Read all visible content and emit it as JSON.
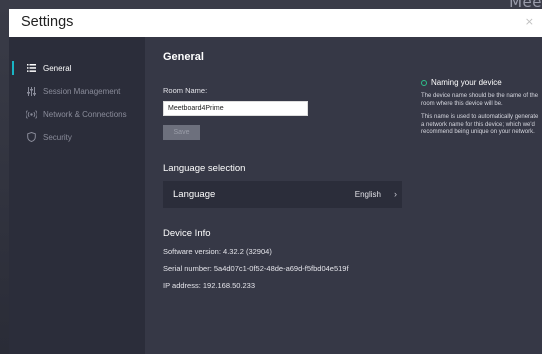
{
  "background_text": "Mee",
  "window": {
    "title": "Settings",
    "close_label": "×"
  },
  "sidebar": {
    "items": [
      {
        "label": "General",
        "icon": "list-icon",
        "active": true
      },
      {
        "label": "Session Management",
        "icon": "sliders-icon",
        "active": false
      },
      {
        "label": "Network & Connections",
        "icon": "broadcast-icon",
        "active": false
      },
      {
        "label": "Security",
        "icon": "shield-icon",
        "active": false
      }
    ]
  },
  "main": {
    "heading": "General",
    "room_name_label": "Room Name:",
    "room_name_value": "Meetboard4Prime",
    "save_label": "Save",
    "language_section": "Language selection",
    "language_label": "Language",
    "language_value": "English",
    "device_info_heading": "Device Info",
    "software_version": "Software version:  4.32.2 (32904)",
    "serial_number": "Serial number:  5a4d07c1-0f52-48de-a69d-f5fbd04e519f",
    "ip_address": "IP address:  192.168.50.233"
  },
  "help": {
    "title": "Naming your device",
    "paragraph1": "The device name should be the name of the room where this device will be.",
    "paragraph2": "This name is used to automatically generate a network name for this device; which we'd recommend being unique on your network."
  },
  "colors": {
    "accent": "#19b4c4",
    "status_dot": "#2dc08a",
    "sidebar": "#2b2d3a",
    "panel": "#363846"
  }
}
